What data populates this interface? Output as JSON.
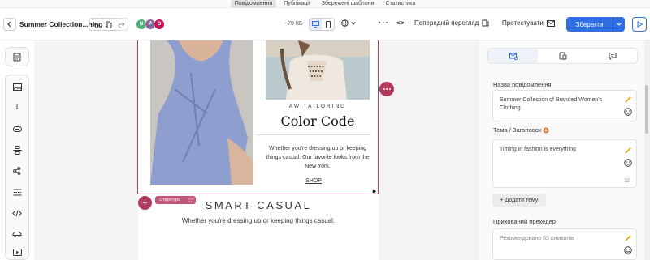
{
  "top_tabs": [
    "Повідомлення",
    "Публікації",
    "Збережені шаблони",
    "Статистика"
  ],
  "toolbar": {
    "title": "Summer Collection...hing",
    "avatars": [
      {
        "initial": "N",
        "color": "#4caf7a"
      },
      {
        "initial": "P",
        "color": "#8a6a9c"
      },
      {
        "initial": "D",
        "color": "#c2185b"
      }
    ],
    "size": "~70 КБ",
    "code_icon": "<>",
    "preview_label": "Попередній перегляд",
    "test_label": "Протестувати",
    "save_label": "Зберегти",
    "accent": "#2f6fe3"
  },
  "sidebar": {
    "tools": [
      "image-icon",
      "text-icon",
      "button-icon",
      "divider-icon",
      "social-icon",
      "spacer-icon",
      "html-icon",
      "product-icon",
      "video-icon"
    ]
  },
  "email": {
    "brand": "AW TAILORING",
    "heading": "Color Code",
    "blurb": "Whether you're dressing up or keeping things casual. Our favorite looks from the New York.",
    "shop": "SHOP",
    "structure_tag": "Структура",
    "smart_title": "SMART CASUAL",
    "smart_sub": "Whether you're dressing up or keeping things casual.",
    "selection_color": "#b23a5c"
  },
  "panel": {
    "name_label": "Назва повідомлення",
    "name_value": "Summer Collection of Branded Women's Clothing",
    "subject_label": "Тема / Заголовок",
    "subject_value": "Timing in fashion is everything",
    "subject_count": "32",
    "add_topic": "+ Додати тему",
    "preheader_label": "Прихований прехедер",
    "preheader_placeholder": "Рекомендовано 65 символів"
  }
}
